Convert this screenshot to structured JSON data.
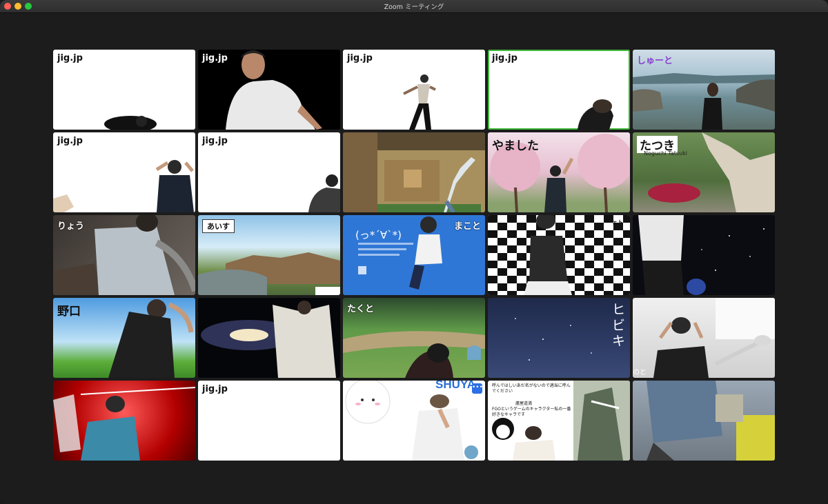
{
  "window": {
    "title": "Zoom ミーティング"
  },
  "participants": [
    {
      "label": "jig.jp"
    },
    {
      "label": "jig.jp"
    },
    {
      "label": "jig.jp"
    },
    {
      "label": "jig.jp"
    },
    {
      "label": "しゅーと"
    },
    {
      "label": "jig.jp"
    },
    {
      "label": "jig.jp"
    },
    {
      "label": ""
    },
    {
      "label": "やました"
    },
    {
      "label": "たつき",
      "sub": "Noguchi Tatsuki"
    },
    {
      "label": "りょう"
    },
    {
      "label": "あいす"
    },
    {
      "label": "まこと",
      "sub": "(っ*´∀`*)"
    },
    {
      "label": "ーェト"
    },
    {
      "label": ""
    },
    {
      "label": "野口"
    },
    {
      "label": ""
    },
    {
      "label": "たくと"
    },
    {
      "label": "ヒビキ"
    },
    {
      "label": "のと"
    },
    {
      "label": ""
    },
    {
      "label": "jig.jp"
    },
    {
      "label": "SHUYA"
    },
    {
      "label": "",
      "sub": "呼んではしいあだ名がないので適当に呼んでください",
      "sub2": "FGOというゲームのキャラクター私の一番好きなキャラです",
      "sub3": "蘆屋道満"
    },
    {
      "label": ""
    }
  ],
  "colors": {
    "active_speaker": "#3fb93a",
    "window_bg": "#1c1c1c"
  }
}
